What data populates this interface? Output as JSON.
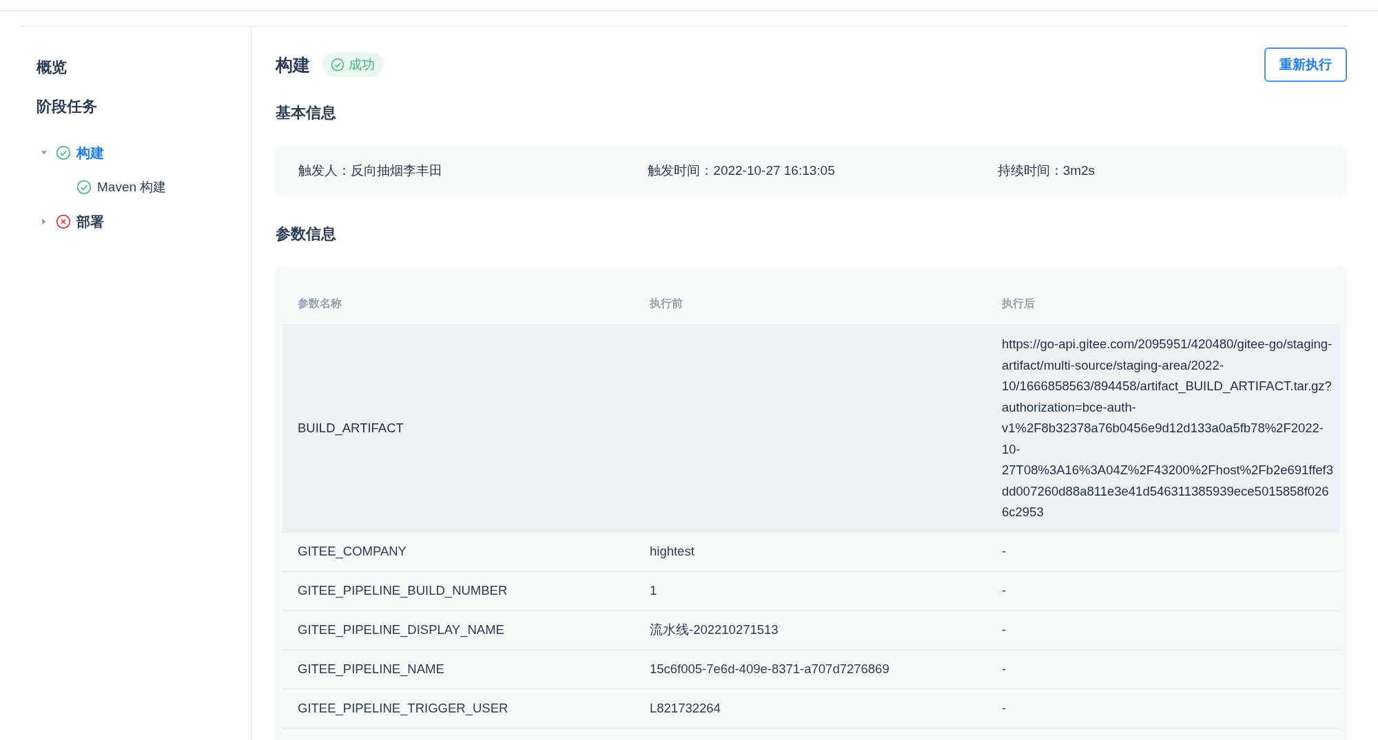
{
  "sidebar": {
    "overview_link": "概览",
    "stages_heading": "阶段任务",
    "stages": [
      {
        "label": "构建",
        "succeeded": true,
        "expanded": true,
        "selected": true,
        "children": [
          {
            "label": "Maven 构建",
            "succeeded": true,
            "selected": false
          }
        ]
      },
      {
        "label": "部署",
        "succeeded": false,
        "expanded": false,
        "selected": false
      }
    ]
  },
  "header": {
    "title": "构建",
    "badge": {
      "label": "成功",
      "succeeded": true
    },
    "button": "重新执行"
  },
  "basic_info": {
    "heading": "基本信息",
    "fields": [
      "触发人：反向抽烟李丰田",
      "触发时间：2022-10-27 16:13:05",
      "持续时间：3m2s"
    ]
  },
  "params": {
    "heading": "参数信息",
    "columns": [
      "参数名称",
      "执行前",
      "执行后"
    ],
    "rows": [
      {
        "highlighted": true,
        "cells": [
          "BUILD_ARTIFACT",
          "",
          "https://go-api.gitee.com/2095951/420480/gitee-go/staging-artifact/multi-source/staging-area/2022-10/1666858563/894458/artifact_BUILD_ARTIFACT.tar.gz?authorization=bce-auth-v1%2F8b32378a76b0456e9d12d133a0a5fb78%2F2022-10-27T08%3A16%3A04Z%2F43200%2Fhost%2Fb2e691ffef3dd007260d88a811e3e41d546311385939ece5015858f0266c2953"
        ]
      },
      {
        "highlighted": false,
        "cells": [
          "GITEE_COMPANY",
          "hightest",
          "-"
        ]
      },
      {
        "highlighted": false,
        "cells": [
          "GITEE_PIPELINE_BUILD_NUMBER",
          "1",
          "-"
        ]
      },
      {
        "highlighted": false,
        "cells": [
          "GITEE_PIPELINE_DISPLAY_NAME",
          "流水线-202210271513",
          "-"
        ]
      },
      {
        "highlighted": false,
        "cells": [
          "GITEE_PIPELINE_NAME",
          "15c6f005-7e6d-409e-8371-a707d7276869",
          "-"
        ]
      },
      {
        "highlighted": false,
        "cells": [
          "GITEE_PIPELINE_TRIGGER_USER",
          "L821732264",
          "-"
        ]
      }
    ]
  }
}
